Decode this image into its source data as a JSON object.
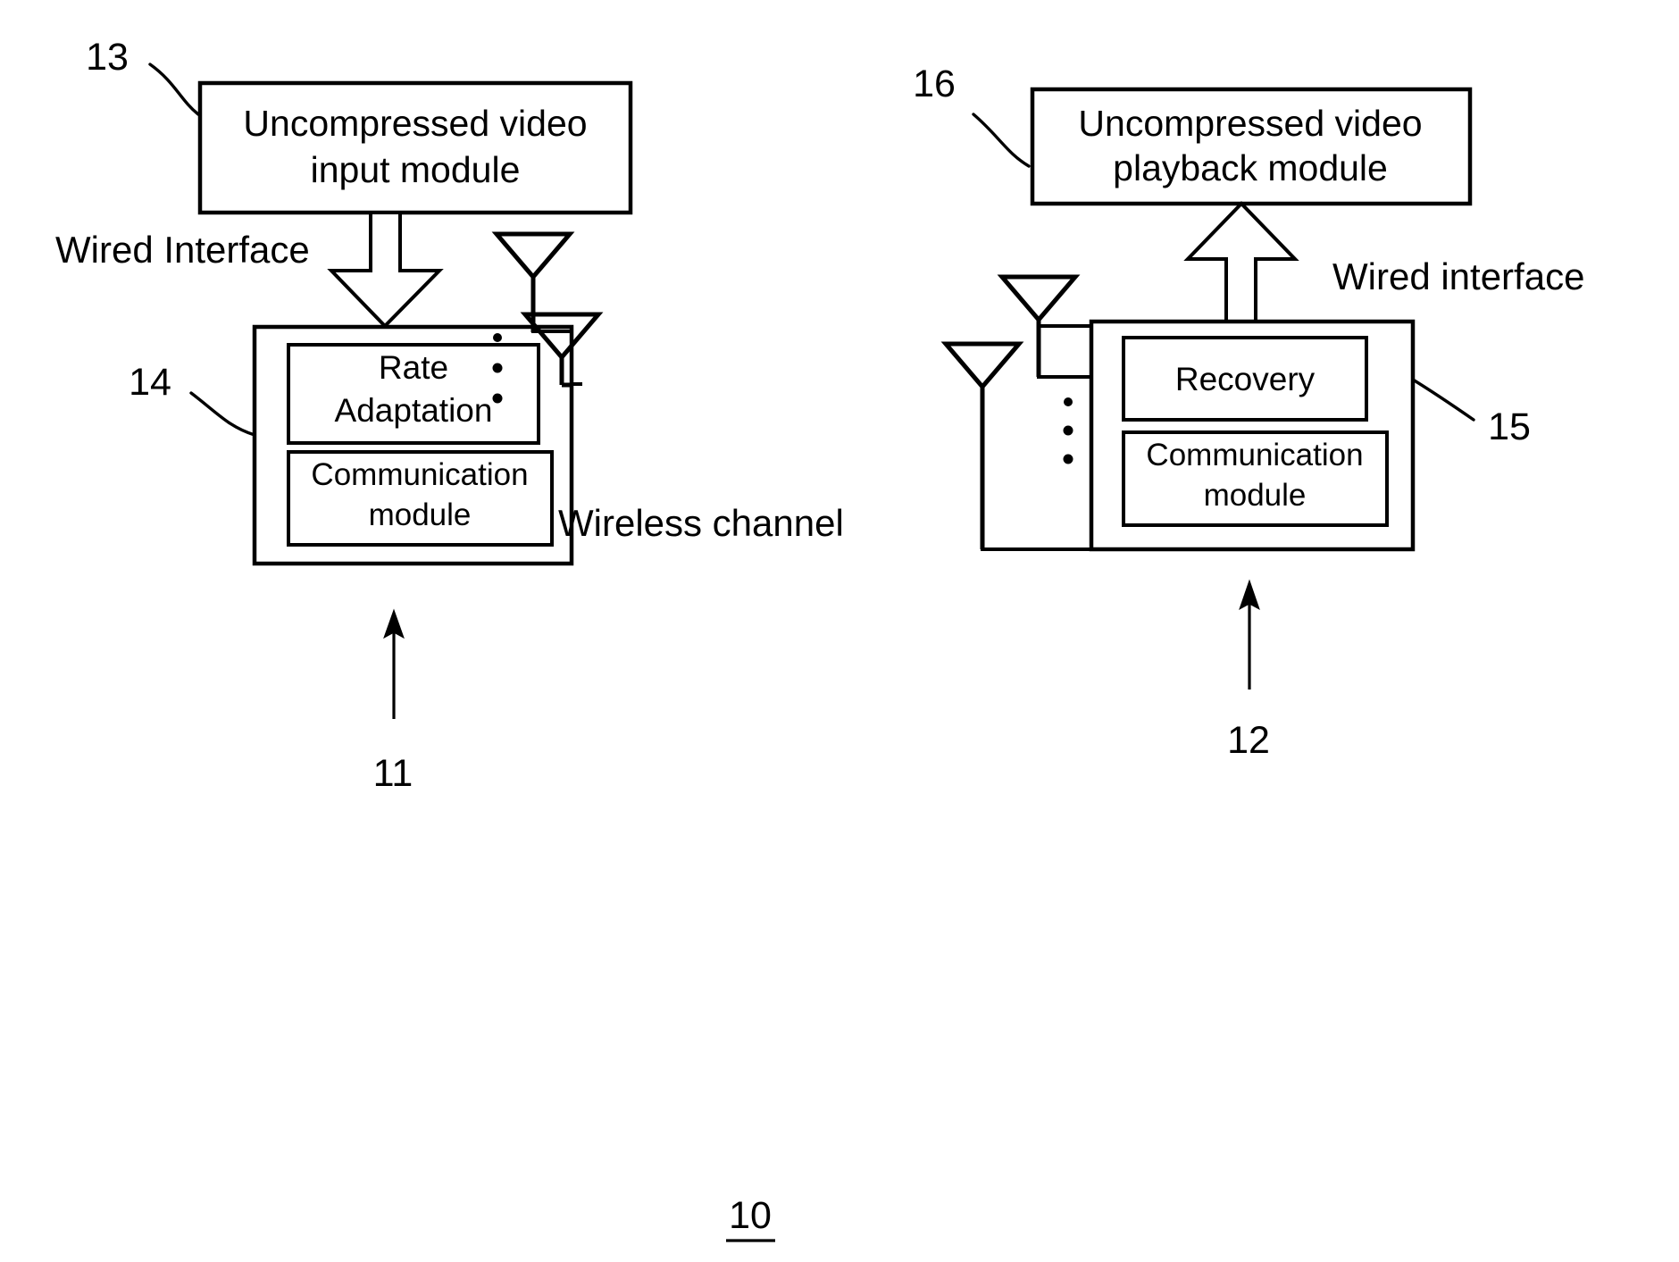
{
  "figure": {
    "number": "10",
    "type": "patent-block-diagram",
    "title_absent": true
  },
  "transmitter": {
    "reference": "11",
    "source_module": {
      "reference": "13",
      "line1": "Uncompressed video",
      "line2": "input module"
    },
    "device": {
      "reference": "14",
      "blocks": [
        {
          "name": "rate-adaptation",
          "line1": "Rate",
          "line2": "Adaptation"
        },
        {
          "name": "communication-module",
          "line1": "Communication",
          "line2": "module"
        }
      ]
    },
    "interface_label": "Wired Interface",
    "antenna_count_indicator": "⋮"
  },
  "receiver": {
    "reference": "12",
    "sink_module": {
      "reference": "16",
      "line1": "Uncompressed video",
      "line2": "playback module"
    },
    "device": {
      "reference": "15",
      "blocks": [
        {
          "name": "recovery",
          "line1": "Recovery",
          "line2": ""
        },
        {
          "name": "communication-module",
          "line1": "Communication",
          "line2": "module"
        }
      ]
    },
    "interface_label": "Wired interface",
    "antenna_count_indicator": "⋮"
  },
  "channel": {
    "label": "Wireless channel"
  },
  "colors": {
    "ink": "#000000",
    "paper": "#ffffff"
  }
}
